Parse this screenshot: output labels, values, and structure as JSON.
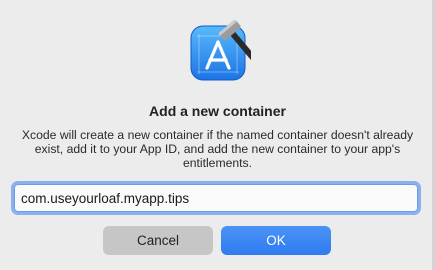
{
  "dialog": {
    "title": "Add a new container",
    "message": "Xcode will create a new container if the named container doesn't already exist, add it to your App ID, and add the new container to your app's entitlements.",
    "icon": "xcode-app-icon"
  },
  "container_field": {
    "value": "com.useyourloaf.myapp.tips"
  },
  "buttons": {
    "cancel_label": "Cancel",
    "ok_label": "OK"
  },
  "colors": {
    "accent": "#2f7bf0",
    "focus_ring": "#8ab1ee",
    "cancel_bg": "#c6c6c6"
  }
}
